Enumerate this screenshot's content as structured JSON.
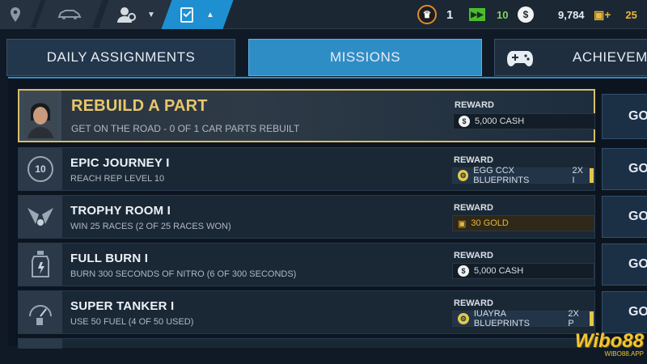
{
  "topbar": {
    "level": "1",
    "tickets": "10",
    "cash": "9,784",
    "gold": "25",
    "colors": {
      "accent": "#1e8fd1",
      "ticket_green": "#4dbb2f"
    }
  },
  "tabs": [
    {
      "label": "DAILY ASSIGNMENTS"
    },
    {
      "label": "MISSIONS"
    },
    {
      "label": "ACHIEVEME"
    }
  ],
  "missions": [
    {
      "title": "REBUILD A PART",
      "subtitle": "GET ON THE ROAD - 0 OF 1 CAR PARTS REBUILT",
      "reward_label": "REWARD",
      "reward_text": "5,000 CASH",
      "reward_extra": "",
      "reward_type": "cash",
      "go": "GO",
      "icon": "avatar-icon"
    },
    {
      "title": "EPIC JOURNEY I",
      "subtitle": "REACH REP LEVEL 10",
      "reward_label": "REWARD",
      "reward_text": "EGG CCX BLUEPRINTS",
      "reward_extra": "2X I",
      "reward_type": "blueprint",
      "go": "GO",
      "icon": "rep-level-icon",
      "icon_text": "10"
    },
    {
      "title": "TROPHY ROOM I",
      "subtitle": "WIN 25 RACES (2 OF 25 RACES WON)",
      "reward_label": "REWARD",
      "reward_text": "30 GOLD",
      "reward_extra": "",
      "reward_type": "gold",
      "go": "GO",
      "icon": "trophy-flags-icon"
    },
    {
      "title": "FULL BURN I",
      "subtitle": "BURN 300 SECONDS OF NITRO (6 OF 300 SECONDS)",
      "reward_label": "REWARD",
      "reward_text": "5,000 CASH",
      "reward_extra": "",
      "reward_type": "cash",
      "go": "GO",
      "icon": "nitro-bottle-icon"
    },
    {
      "title": "SUPER TANKER I",
      "subtitle": "USE 50 FUEL (4 OF 50 USED)",
      "reward_label": "REWARD",
      "reward_text": "IUAYRA BLUEPRINTS",
      "reward_extra": "2X P",
      "reward_type": "blueprint",
      "go": "GO",
      "icon": "fuel-gauge-icon"
    }
  ],
  "watermark": {
    "brand": "Wibo88",
    "url": "WIBO88.APP"
  }
}
